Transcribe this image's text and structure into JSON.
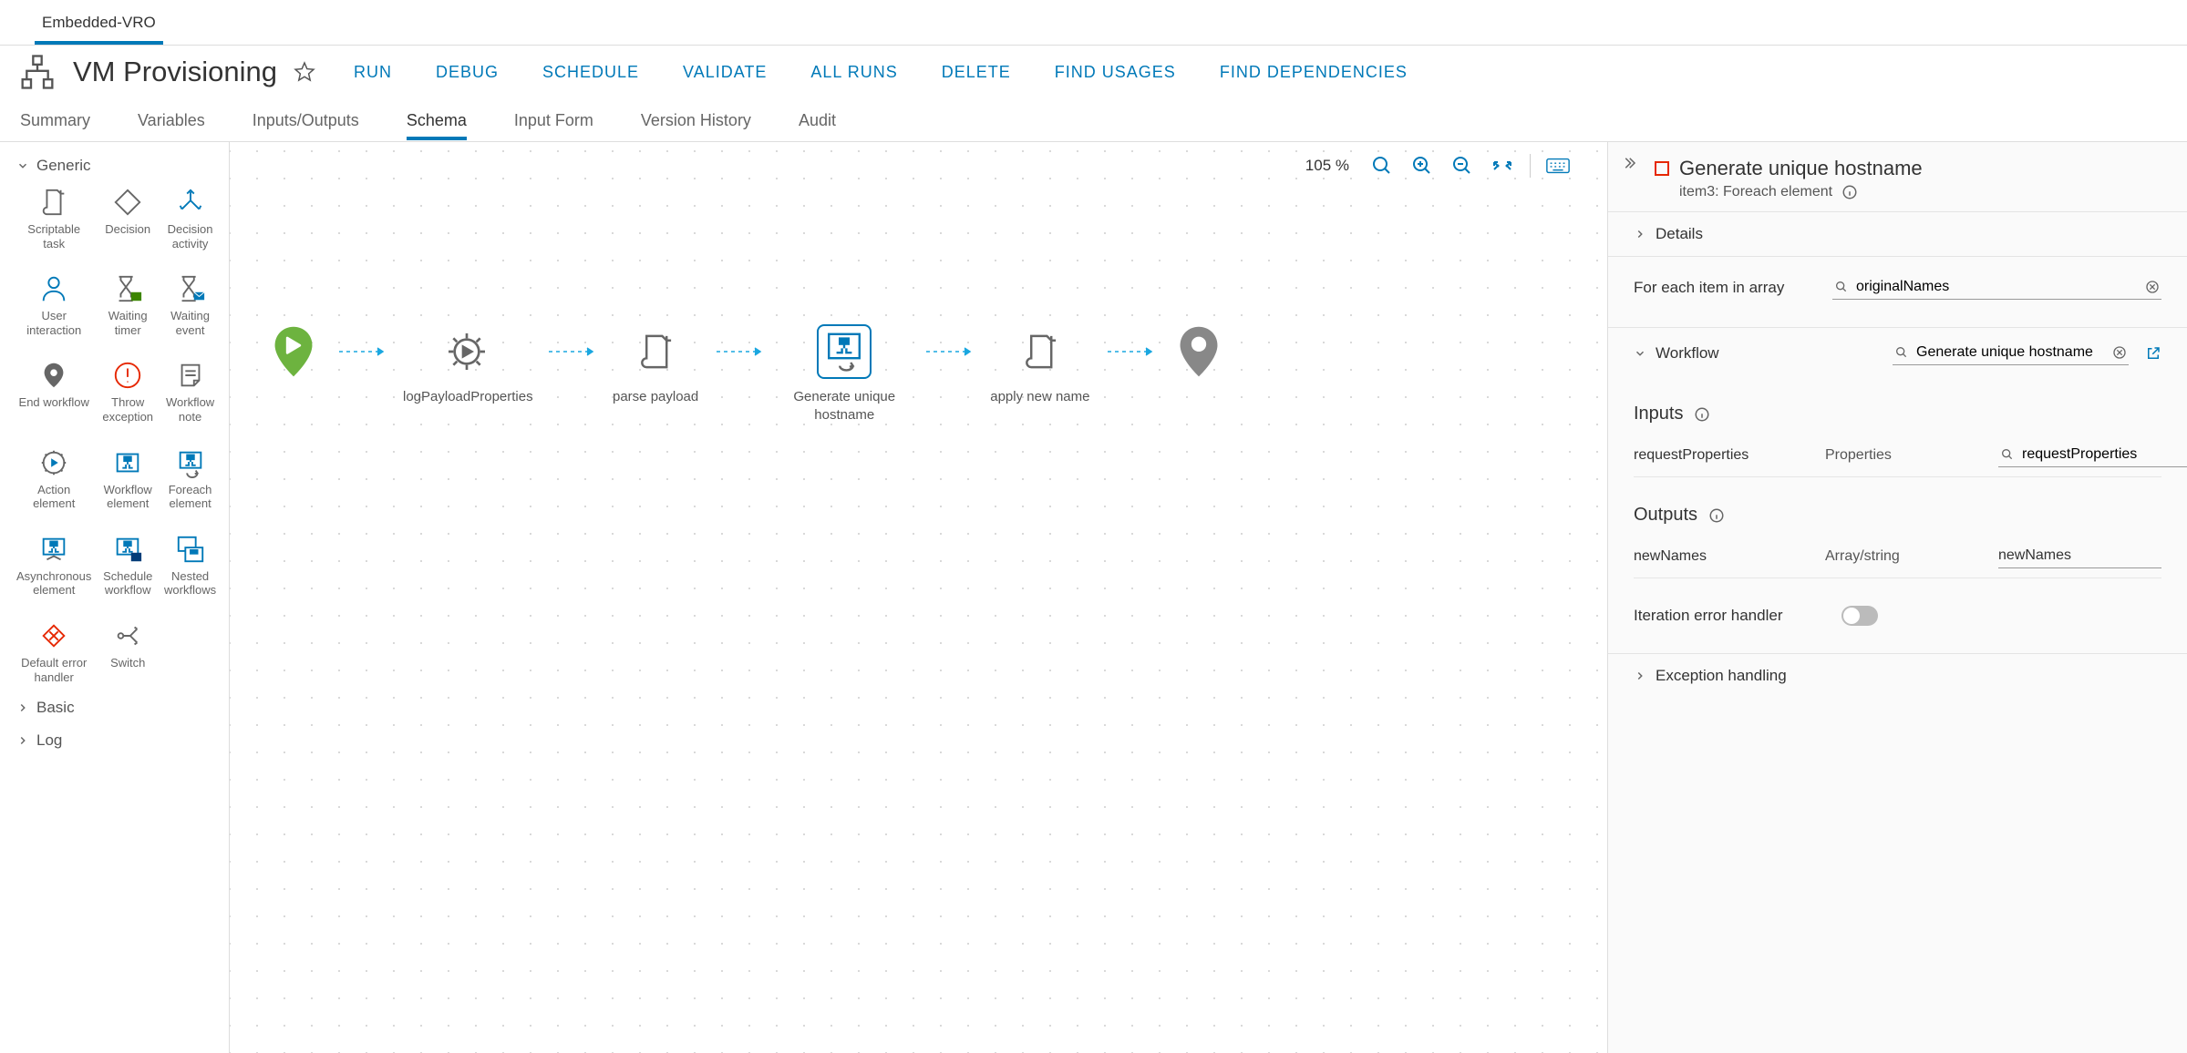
{
  "topTab": "Embedded-VRO",
  "workflow": {
    "title": "VM Provisioning"
  },
  "actions": [
    "RUN",
    "DEBUG",
    "SCHEDULE",
    "VALIDATE",
    "ALL RUNS",
    "DELETE",
    "FIND USAGES",
    "FIND DEPENDENCIES"
  ],
  "subTabs": [
    "Summary",
    "Variables",
    "Inputs/Outputs",
    "Schema",
    "Input Form",
    "Version History",
    "Audit"
  ],
  "activeSubTab": "Schema",
  "palette": {
    "groups": [
      {
        "name": "Generic",
        "expanded": true,
        "items": [
          "Scriptable task",
          "Decision",
          "Decision activity",
          "User interaction",
          "Waiting timer",
          "Waiting event",
          "End workflow",
          "Throw exception",
          "Workflow note",
          "Action element",
          "Workflow element",
          "Foreach element",
          "Asynchronous element",
          "Schedule workflow",
          "Nested workflows",
          "Default error handler",
          "Switch"
        ]
      },
      {
        "name": "Basic",
        "expanded": false,
        "items": []
      },
      {
        "name": "Log",
        "expanded": false,
        "items": []
      }
    ]
  },
  "zoom": "105 %",
  "flow": [
    {
      "id": "start",
      "label": ""
    },
    {
      "id": "log",
      "label": "logPayloadProperties"
    },
    {
      "id": "parse",
      "label": "parse payload"
    },
    {
      "id": "gen",
      "label": "Generate unique hostname",
      "selected": true
    },
    {
      "id": "apply",
      "label": "apply new name"
    },
    {
      "id": "end",
      "label": ""
    }
  ],
  "inspector": {
    "title": "Generate unique hostname",
    "subtitle": "item3: Foreach element",
    "details": "Details",
    "forEachLabel": "For each item in array",
    "forEachValue": "originalNames",
    "workflowLabel": "Workflow",
    "workflowValue": "Generate unique hostname",
    "inputsLabel": "Inputs",
    "inputs": [
      {
        "name": "requestProperties",
        "type": "Properties",
        "value": "requestProperties"
      }
    ],
    "outputsLabel": "Outputs",
    "outputs": [
      {
        "name": "newNames",
        "type": "Array/string",
        "value": "newNames"
      }
    ],
    "iterErr": "Iteration error handler",
    "excHandling": "Exception handling"
  }
}
